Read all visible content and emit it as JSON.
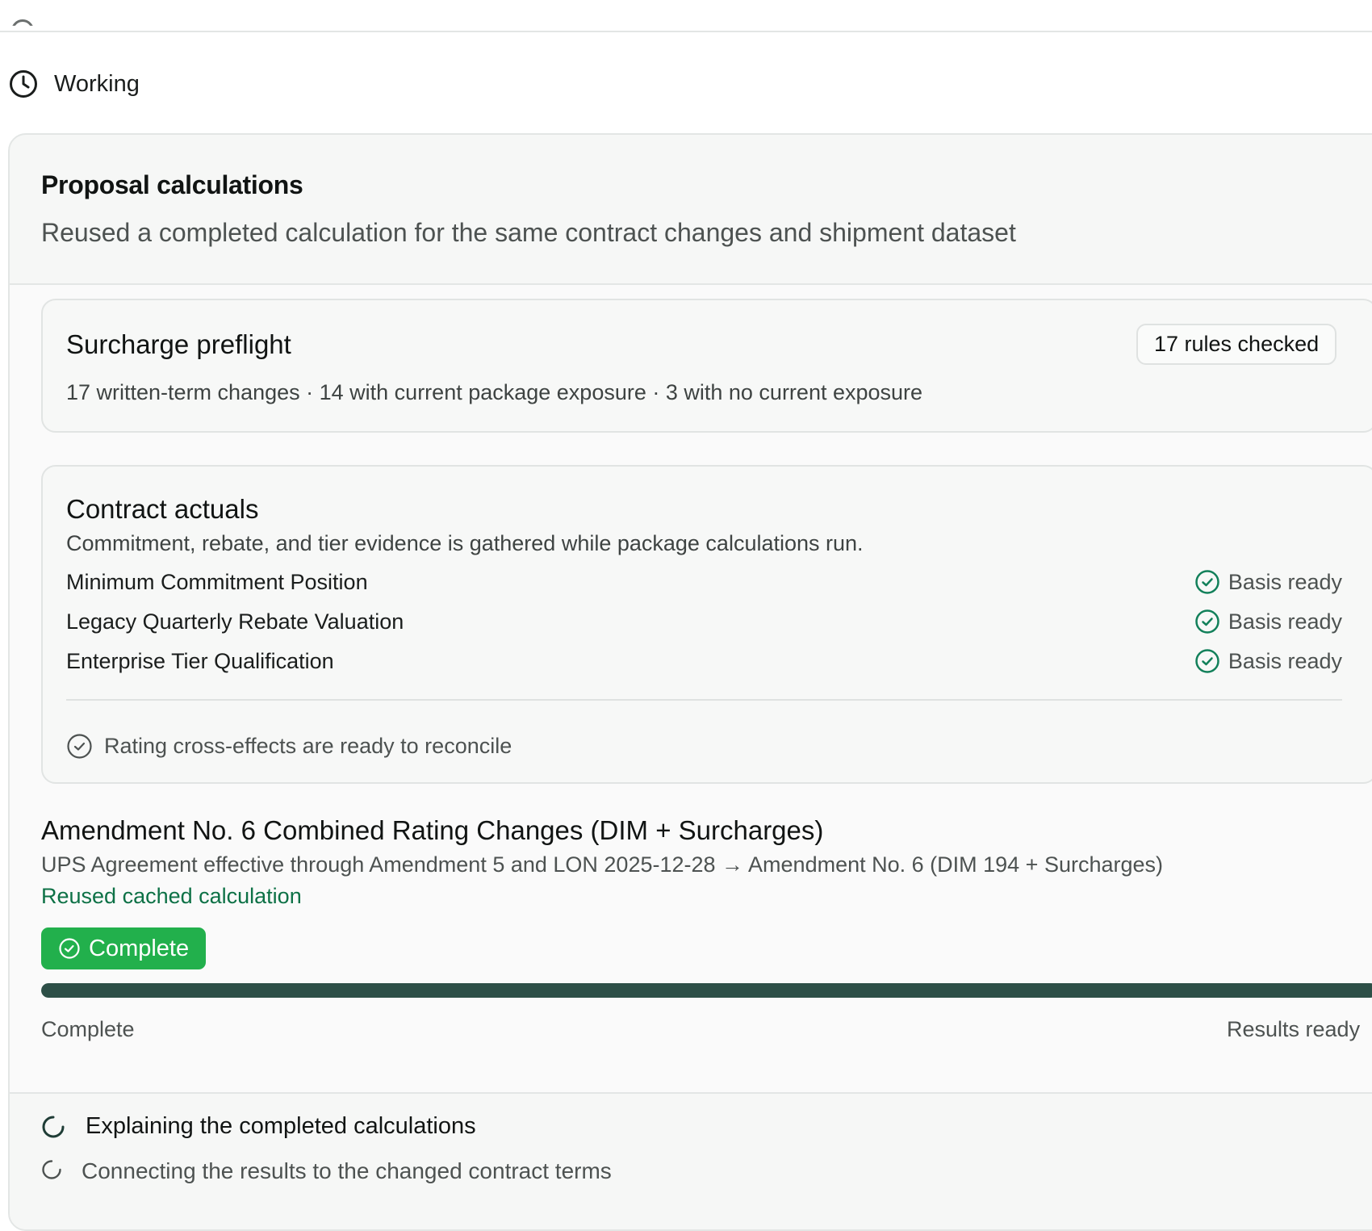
{
  "status": {
    "label": "Working",
    "icon": "clock-icon"
  },
  "panel": {
    "title": "Proposal calculations",
    "subtitle": "Reused a completed calculation for the same contract changes and shipment dataset"
  },
  "preflight": {
    "title": "Surcharge preflight",
    "badge": "17 rules checked",
    "summary": "17 written-term changes · 14 with current package exposure · 3 with no current exposure"
  },
  "actuals": {
    "title": "Contract actuals",
    "description": "Commitment, rebate, and tier evidence is gathered while package calculations run.",
    "rows": [
      {
        "name": "Minimum Commitment Position",
        "status": "Basis ready"
      },
      {
        "name": "Legacy Quarterly Rebate Valuation",
        "status": "Basis ready"
      },
      {
        "name": "Enterprise Tier Qualification",
        "status": "Basis ready"
      }
    ],
    "footer": "Rating cross-effects are ready to reconcile"
  },
  "amendment": {
    "title": "Amendment No. 6 Combined Rating Changes (DIM + Surcharges)",
    "subtitle": "UPS Agreement effective through Amendment 5 and LON 2025-12-28 → Amendment No. 6 (DIM 194 + Surcharges)",
    "link": "Reused cached calculation",
    "pill": "Complete",
    "progress": 1.0,
    "progress_left": "Complete",
    "progress_right": "Results ready"
  },
  "steps": {
    "main": "Explaining the completed calculations",
    "sub": "Connecting the results to the changed contract terms"
  },
  "colors": {
    "accent_green": "#22b04c",
    "check_green": "#12805a",
    "link_green": "#0d7146",
    "progress_fill": "#2d4f47"
  }
}
